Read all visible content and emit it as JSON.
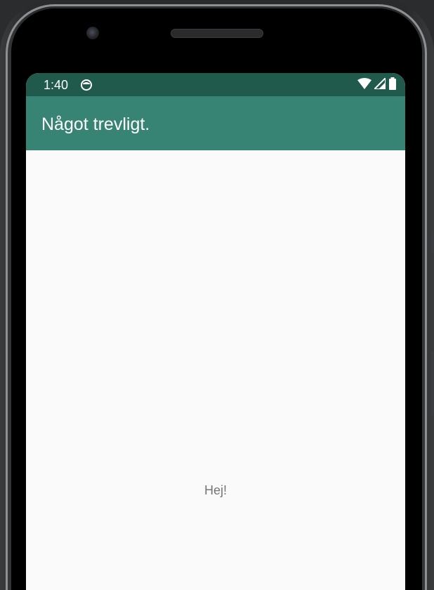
{
  "status_bar": {
    "time": "1:40",
    "background": "#205a4d",
    "icons": [
      "notification-icon",
      "wifi-icon",
      "cell-signal-icon",
      "battery-icon"
    ]
  },
  "app_bar": {
    "title": "Något trevligt.",
    "background": "#388474"
  },
  "content": {
    "text": "Hej!",
    "background": "#fafafa"
  },
  "colors": {
    "bezel": "#2a2b2d",
    "text_secondary": "#757575"
  }
}
